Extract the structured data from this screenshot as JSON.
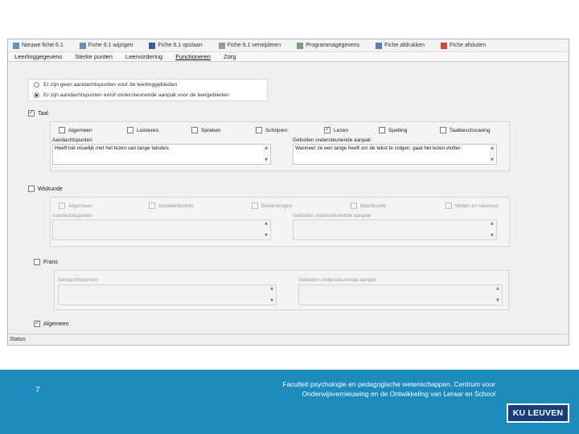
{
  "toolbar": {
    "items": [
      {
        "label": "Nieuwe fiche 6.1",
        "icon": "new-file-icon",
        "color": "#6b8fbf"
      },
      {
        "label": "Fiche 6.1 wijzigen",
        "icon": "edit-file-icon",
        "color": "#6b8fbf"
      },
      {
        "label": "Fiche 6.1 opslaan",
        "icon": "save-icon",
        "color": "#3a5d9b"
      },
      {
        "label": "Fiche 6.1 verwijderen",
        "icon": "delete-icon",
        "color": "#9a9a9a"
      },
      {
        "label": "Programmagegevens",
        "icon": "grid-icon",
        "color": "#7aa07a"
      },
      {
        "label": "Fiche afdrukken",
        "icon": "print-icon",
        "color": "#5b7fb0"
      },
      {
        "label": "Fiche afsluiten",
        "icon": "close-icon",
        "color": "#d04a3a"
      }
    ]
  },
  "menu": {
    "items": [
      "Leerlinggegevens",
      "Sterke punten",
      "Leervordering",
      "Functioneren",
      "Zorg"
    ],
    "active_index": 3
  },
  "radios": [
    {
      "label": "Er zijn geen aandachtspunten voor de leerlinggebieden",
      "checked": false
    },
    {
      "label": "Er zijn aandachtspunten en/of ondersteunende aanpak voor de leergebieden",
      "checked": true
    }
  ],
  "sections": {
    "taal": {
      "label": "Taal",
      "checked": true,
      "options": [
        {
          "label": "Algemeen",
          "checked": false
        },
        {
          "label": "Luisteren",
          "checked": false
        },
        {
          "label": "Spreken",
          "checked": false
        },
        {
          "label": "Schrijven",
          "checked": false
        },
        {
          "label": "Lezen",
          "checked": true
        },
        {
          "label": "Spelling",
          "checked": false
        },
        {
          "label": "Taalbeschouwing",
          "checked": false
        }
      ],
      "left_label": "Aandachtspunten",
      "left_value": "Heeft het moeilijk met het lezen van lange teksten.",
      "right_label": "Geboden ondersteunende aanpak",
      "right_value": "Wanneer ze een lange heeft om de tekst te volgen, gaat het lezen vlotter."
    },
    "wiskunde": {
      "label": "Wiskunde",
      "checked": false,
      "options": [
        {
          "label": "Algemeen",
          "checked": false
        },
        {
          "label": "Getallenkennis",
          "checked": false
        },
        {
          "label": "Bewerkingen",
          "checked": false
        },
        {
          "label": "Meetkunde",
          "checked": false
        },
        {
          "label": "Meten en rekenen",
          "checked": false
        }
      ],
      "left_label": "Aandachtspunten",
      "right_label": "Geboden ondersteunende aanpak"
    },
    "frans": {
      "label": "Frans",
      "checked": false,
      "left_label": "Aandachtspunten",
      "right_label": "Geboden ondersteunende aanpak"
    },
    "algemeen": {
      "label": "Algemeen",
      "checked": true
    }
  },
  "status": "Status",
  "footer": {
    "page_number": "7",
    "text": "Faculteit psychologie en pedagogische wetenschappen, Centrum voor Onderwijsvernieuwing en de Ontwikkeling van Leraar en School",
    "logo": "KU LEUVEN"
  }
}
